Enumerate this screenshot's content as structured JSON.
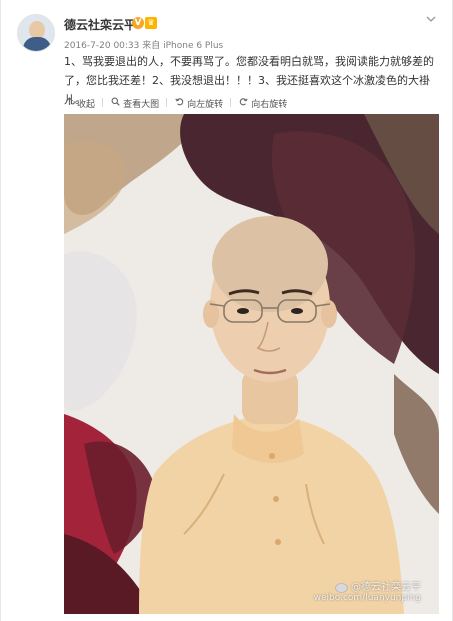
{
  "post": {
    "username": "德云社栾云平",
    "v_badge": "V",
    "crown": "♛",
    "meta": "2016-7-20 00:33 来自 iPhone 6 Plus",
    "content": "1、骂我要退出的人，不要再骂了。您都没看明白就骂，我阅读能力就够差的了，您比我还差！2、我没想退出！！！3、我还挺喜欢这个冰激凌色的大褂儿。"
  },
  "toolbar": {
    "collapse_label": "收起",
    "view_large_label": "查看大图",
    "rotate_left_label": "向左旋转",
    "rotate_right_label": "向右旋转"
  },
  "watermark": {
    "line1": "@德云社栾云平",
    "line2": "weibo.com/luanyunping"
  },
  "colors": {
    "background": "#ffffff",
    "text": "#333333",
    "meta": "#808080",
    "badge": "#f5a623"
  }
}
